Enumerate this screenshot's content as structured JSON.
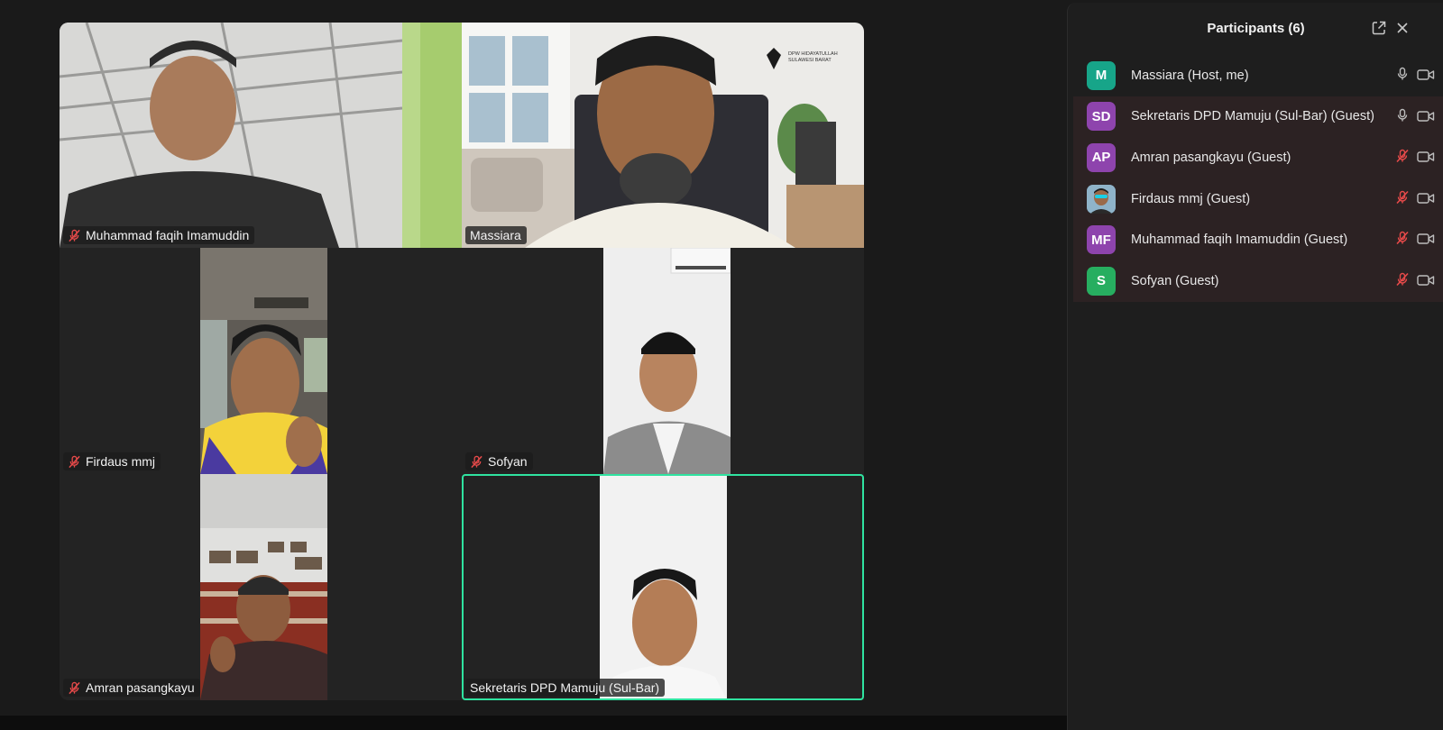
{
  "panel": {
    "title": "Participants (6)",
    "participants": [
      {
        "initials": "M",
        "name": "Massiara (Host, me)",
        "avatar_color": "#17a589",
        "mic": "on",
        "highlighted": false
      },
      {
        "initials": "SD",
        "name": "Sekretaris DPD Mamuju (Sul-Bar) (Guest)",
        "avatar_color": "#8e44ad",
        "mic": "on",
        "highlighted": true
      },
      {
        "initials": "AP",
        "name": "Amran pasangkayu (Guest)",
        "avatar_color": "#8e44ad",
        "mic": "muted",
        "highlighted": true
      },
      {
        "initials": "",
        "name": "Firdaus mmj (Guest)",
        "avatar_color": "#4a6a8a",
        "mic": "muted",
        "highlighted": true,
        "avatar_type": "photo"
      },
      {
        "initials": "MF",
        "name": "Muhammad faqih Imamuddin (Guest)",
        "avatar_color": "#8e44ad",
        "mic": "muted",
        "highlighted": true
      },
      {
        "initials": "S",
        "name": "Sofyan (Guest)",
        "avatar_color": "#27ae60",
        "mic": "muted",
        "highlighted": true
      }
    ]
  },
  "gallery": {
    "active_speaker_color": "#2fe3a0",
    "tiles": [
      {
        "name": "Muhammad faqih Imamuddin",
        "muted": true
      },
      {
        "name": "Massiara",
        "muted": false
      },
      {
        "name": "Firdaus mmj",
        "muted": true
      },
      {
        "name": "Sofyan",
        "muted": true
      },
      {
        "name": "Amran pasangkayu",
        "muted": true
      },
      {
        "name": "Sekretaris DPD Mamuju (Sul-Bar)",
        "muted": false,
        "active_speaker": true
      }
    ],
    "background_logo_text": [
      "DPW HIDAYATULLAH",
      "SULAWESI BARAT"
    ]
  }
}
